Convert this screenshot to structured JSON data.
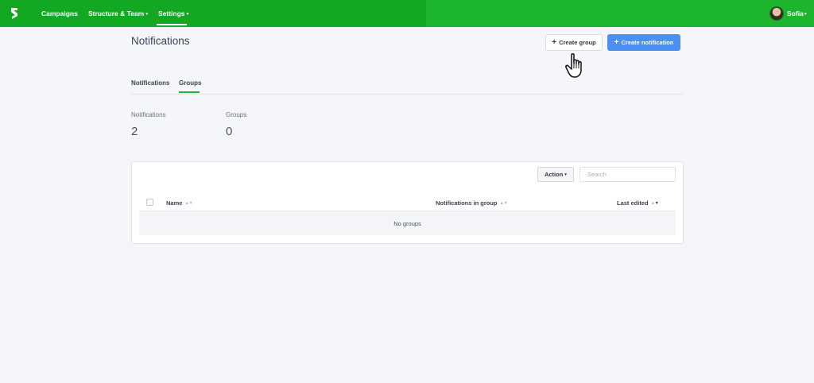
{
  "nav": {
    "items": [
      {
        "label": "Campaigns",
        "has_caret": false
      },
      {
        "label": "Structure & Team",
        "has_caret": true
      },
      {
        "label": "Settings",
        "has_caret": true,
        "active": true
      }
    ],
    "caret": "▾",
    "user": {
      "name": "Sofia"
    },
    "logo_icon": "brand-logo-icon"
  },
  "page": {
    "title": "Notifications"
  },
  "actions": {
    "create_group": "Create group",
    "create_notification": "Create notification",
    "plus": "+"
  },
  "tabs": [
    {
      "label": "Notifications",
      "active": false
    },
    {
      "label": "Groups",
      "active": true
    }
  ],
  "stats": [
    {
      "label": "Notifications",
      "value": "2"
    },
    {
      "label": "Groups",
      "value": "0"
    }
  ],
  "table": {
    "action_label": "Action",
    "search_placeholder": "Search",
    "columns": [
      {
        "label": "Name",
        "sort": "none"
      },
      {
        "label": "Notifications in group",
        "sort": "none"
      },
      {
        "label": "Last edited",
        "sort": "desc"
      }
    ],
    "empty_message": "No groups"
  },
  "colors": {
    "header_green": "#1db42e",
    "primary_blue": "#4b8ff0",
    "tab_active_underline": "#1db42e"
  }
}
